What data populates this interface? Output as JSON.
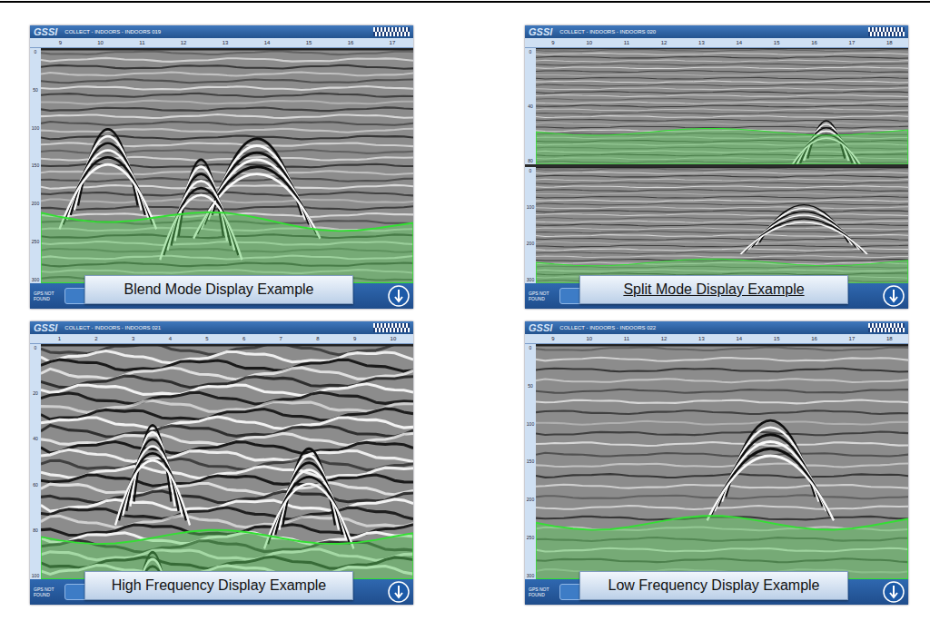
{
  "page": {
    "figures": [
      {
        "kind": "blend",
        "caption": "Blend Mode Display Example",
        "underlined": false,
        "app": {
          "logo": "GSSI",
          "title": "COLLECT - INDOORS - INDOORS 019",
          "gps": "GPS NOT FOUND",
          "ruler": [
            "9",
            "10",
            "11",
            "12",
            "13",
            "14",
            "15",
            "16",
            "17"
          ],
          "panes": [
            {
              "depth": [
                "0",
                "50",
                "100",
                "150",
                "200",
                "250",
                "300"
              ]
            }
          ]
        }
      },
      {
        "kind": "split",
        "caption": "Split Mode Display Example",
        "underlined": true,
        "app": {
          "logo": "GSSI",
          "title": "COLLECT - INDOORS - INDOORS 020",
          "gps": "GPS NOT FOUND",
          "ruler": [
            "9",
            "10",
            "11",
            "12",
            "13",
            "14",
            "15",
            "16",
            "17",
            "18"
          ],
          "panes": [
            {
              "depth": [
                "0",
                "40",
                "80"
              ]
            },
            {
              "depth": [
                "0",
                "100",
                "200",
                "300"
              ]
            }
          ]
        }
      },
      {
        "kind": "high",
        "caption": "High Frequency Display Example",
        "underlined": false,
        "app": {
          "logo": "GSSI",
          "title": "COLLECT - INDOORS - INDOORS 021",
          "gps": "GPS NOT FOUND",
          "ruler": [
            "1",
            "2",
            "3",
            "4",
            "5",
            "6",
            "7",
            "8",
            "9",
            "10"
          ],
          "panes": [
            {
              "depth": [
                "0",
                "20",
                "40",
                "60",
                "80",
                "100"
              ]
            }
          ]
        }
      },
      {
        "kind": "low",
        "caption": "Low Frequency Display Example",
        "underlined": false,
        "app": {
          "logo": "GSSI",
          "title": "COLLECT - INDOORS - INDOORS 022",
          "gps": "GPS NOT FOUND",
          "ruler": [
            "9",
            "10",
            "11",
            "12",
            "13",
            "14",
            "15",
            "16",
            "17",
            "18"
          ],
          "panes": [
            {
              "depth": [
                "0",
                "50",
                "100",
                "150",
                "200",
                "250",
                "300"
              ]
            }
          ]
        }
      }
    ]
  }
}
